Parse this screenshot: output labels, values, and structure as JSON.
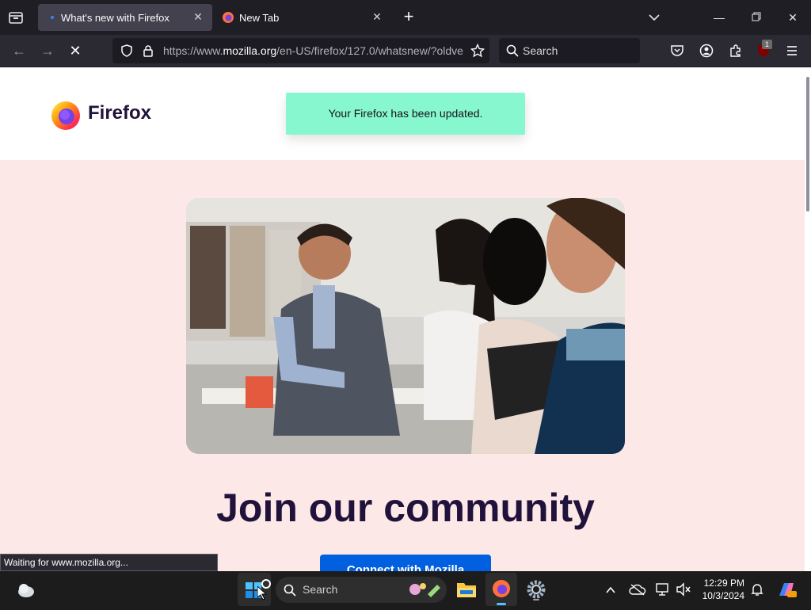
{
  "browser": {
    "tabs": [
      {
        "title": "What's new with Firefox",
        "active": true
      },
      {
        "title": "New Tab",
        "active": false
      }
    ],
    "url": {
      "prefix": "https://www.",
      "domain": "mozilla.org",
      "rest": "/en-US/firefox/127.0/whatsnew/?oldve"
    },
    "search_placeholder": "Search",
    "extension_badge": "1"
  },
  "page": {
    "logo_text": "Firefox",
    "notice": "Your Firefox has been updated.",
    "heading": "Join our community",
    "cta_label": "Connect with Mozilla",
    "status_text": "Waiting for www.mozilla.org..."
  },
  "taskbar": {
    "search_label": "Search",
    "time": "12:29 PM",
    "date": "10/3/2024"
  },
  "colors": {
    "accent": "#0060df",
    "notice_bg": "#87f7cf",
    "hero_bg": "#fde8e8",
    "heading": "#20123a"
  }
}
